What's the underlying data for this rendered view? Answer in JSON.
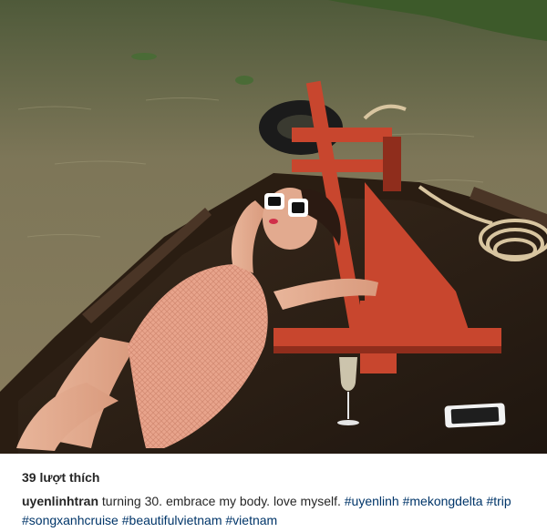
{
  "post": {
    "likes_text": "39 lượt thích",
    "username": "uyenlinhtran",
    "caption_text": "turning 30. embrace my body. love myself.",
    "hashtags": [
      "#uyenlinh",
      "#mekongdelta",
      "#trip",
      "#songxanhcruise",
      "#beautifulvietnam",
      "#vietnam"
    ]
  },
  "colors": {
    "text": "#262626",
    "hashtag": "#003569",
    "boat_red": "#c8462e",
    "river": "#7a7455"
  }
}
